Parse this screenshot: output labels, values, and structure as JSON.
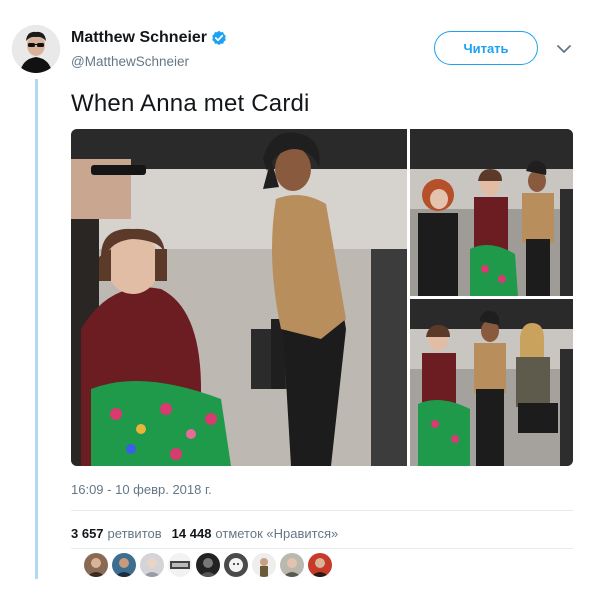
{
  "author": {
    "display_name": "Matthew Schneier",
    "username": "@MatthewSchneier",
    "verified": true,
    "avatar_icon": "user-avatar-icon"
  },
  "follow_button": {
    "label": "Читать"
  },
  "menu": {
    "icon": "chevron-down-icon"
  },
  "tweet": {
    "text": "When Anna met Cardi",
    "timestamp": "16:09 - 10 февр. 2018 г."
  },
  "media": {
    "photos": [
      {
        "name": "photo-main"
      },
      {
        "name": "photo-top-right"
      },
      {
        "name": "photo-bottom-right"
      }
    ]
  },
  "stats": {
    "retweets": {
      "count": "3 657",
      "label": "ретвитов"
    },
    "likes": {
      "count": "14 448",
      "label": "отметок «Нравится»"
    }
  },
  "likers_count_shown": 9,
  "colors": {
    "accent": "#1da1f2",
    "text": "#14171a",
    "secondary": "#657786",
    "thread_line": "#b3d9f2"
  }
}
